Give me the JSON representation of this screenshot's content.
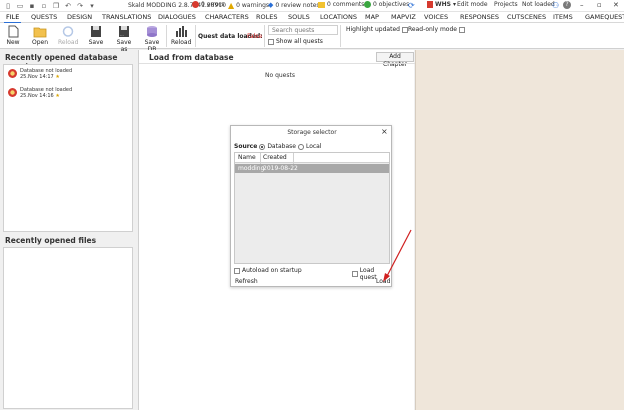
{
  "titlebar": {
    "title": "Skald MODDING 2.8.7241.28910",
    "errors": "0 errors",
    "warnings": "0 warnings",
    "review_notes": "0 review notes",
    "comments": "0 comments",
    "objectives": "0 objectives",
    "workspace": "WHS",
    "edit_mode": "Edit mode",
    "projects": "Projects",
    "not_loaded": "Not loaded"
  },
  "menu": [
    "FILE",
    "QUESTS",
    "DESIGN",
    "TRANSLATIONS",
    "DIALOGUES",
    "CHARACTERS",
    "ROLES",
    "SOULS",
    "LOCATIONS",
    "MAP",
    "MAPVIZ",
    "VOICES",
    "RESPONSES",
    "CUTSCENES",
    "ITEMS",
    "GAMEQUESTS"
  ],
  "toolbar": {
    "new": "New",
    "open": "Open",
    "reload_disabled": "Reload",
    "save": "Save",
    "save_as": "Save as",
    "save_db": "Save DB",
    "reload": "Reload",
    "quest_data_label": "Quest data loaded:",
    "quest_data_value": "False",
    "search_placeholder": "Search quests",
    "show_all_quests": "Show all quests",
    "highlight_updated": "Highlight updated",
    "read_only_mode": "Read-only mode"
  },
  "recent_quests": {
    "title": "Recently opened database quests",
    "items": [
      {
        "name": "Database not loaded",
        "date": "25.Nov 14:17"
      },
      {
        "name": "Database not loaded",
        "date": "25.Nov 14:16"
      }
    ]
  },
  "recent_files": {
    "title": "Recently opened files"
  },
  "center": {
    "title": "Load from database",
    "add_chapter": "Add Chapter",
    "empty": "No quests"
  },
  "dialog": {
    "title": "Storage selector",
    "source_label": "Source",
    "source_database": "Database",
    "source_local": "Local",
    "col_name": "Name",
    "col_created": "Created",
    "rows": [
      {
        "name": "modding",
        "created": "2019-08-22"
      }
    ],
    "autoload": "Autoload on startup",
    "load_quest": "Load quest",
    "refresh": "Refresh",
    "load": "Load"
  },
  "colors": {
    "accent": "#2a6fd6",
    "false_red": "#e03030",
    "side_bg": "#efe6da",
    "selected_row": "#a8a8a8",
    "arrow": "#d02020"
  }
}
